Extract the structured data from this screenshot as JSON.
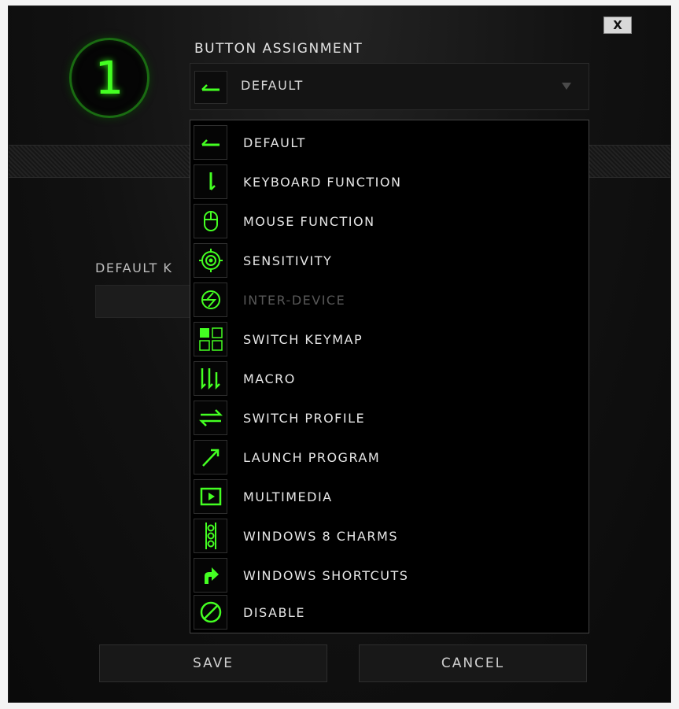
{
  "dialog": {
    "close_label": "X",
    "badge_number": "1",
    "section_title": "BUTTON ASSIGNMENT",
    "default_key_label": "DEFAULT K"
  },
  "select": {
    "selected_label": "DEFAULT",
    "selected_icon": "default-arrow-icon"
  },
  "menu": {
    "items": [
      {
        "label": "DEFAULT",
        "icon": "default-arrow-icon",
        "enabled": true
      },
      {
        "label": "KEYBOARD FUNCTION",
        "icon": "keyboard-function-icon",
        "enabled": true
      },
      {
        "label": "MOUSE FUNCTION",
        "icon": "mouse-icon",
        "enabled": true
      },
      {
        "label": "SENSITIVITY",
        "icon": "sensitivity-target-icon",
        "enabled": true
      },
      {
        "label": "INTER-DEVICE",
        "icon": "inter-device-icon",
        "enabled": false
      },
      {
        "label": "SWITCH KEYMAP",
        "icon": "keymap-grid-icon",
        "enabled": true
      },
      {
        "label": "MACRO",
        "icon": "macro-icon",
        "enabled": true
      },
      {
        "label": "SWITCH PROFILE",
        "icon": "switch-arrows-icon",
        "enabled": true
      },
      {
        "label": "LAUNCH PROGRAM",
        "icon": "launch-arrow-icon",
        "enabled": true
      },
      {
        "label": "MULTIMEDIA",
        "icon": "play-icon",
        "enabled": true
      },
      {
        "label": "WINDOWS 8 CHARMS",
        "icon": "charms-icon",
        "enabled": true
      },
      {
        "label": "WINDOWS SHORTCUTS",
        "icon": "shortcut-arrow-icon",
        "enabled": true
      },
      {
        "label": "DISABLE",
        "icon": "disable-icon",
        "enabled": true
      }
    ]
  },
  "footer": {
    "save_label": "SAVE",
    "cancel_label": "CANCEL"
  },
  "colors": {
    "accent": "#44ff22",
    "accent_dim": "#1a6b12",
    "disabled_text": "#585858"
  }
}
